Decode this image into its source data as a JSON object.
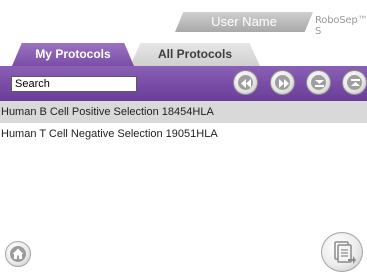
{
  "header": {
    "user_label": "User Name",
    "brand": "RoboSep™-S"
  },
  "tabs": [
    {
      "label": "My Protocols",
      "active": true
    },
    {
      "label": "All Protocols",
      "active": false
    }
  ],
  "search": {
    "value": "Search"
  },
  "nav_buttons": [
    "rewind-icon",
    "fast-forward-icon",
    "scroll-down-icon",
    "scroll-up-icon"
  ],
  "protocols": [
    {
      "name": "Human B Cell Positive Selection 18454HLA",
      "selected": true
    },
    {
      "name": "Human T Cell Negative Selection 19051HLA",
      "selected": false
    }
  ],
  "bottom": {
    "home_icon": "home-icon",
    "protocol_icon": "protocol-document-icon"
  },
  "colors": {
    "accent": "#7a4ea6",
    "selected_row": "#d9d9d9",
    "button_gray": "#9e9e9e"
  }
}
